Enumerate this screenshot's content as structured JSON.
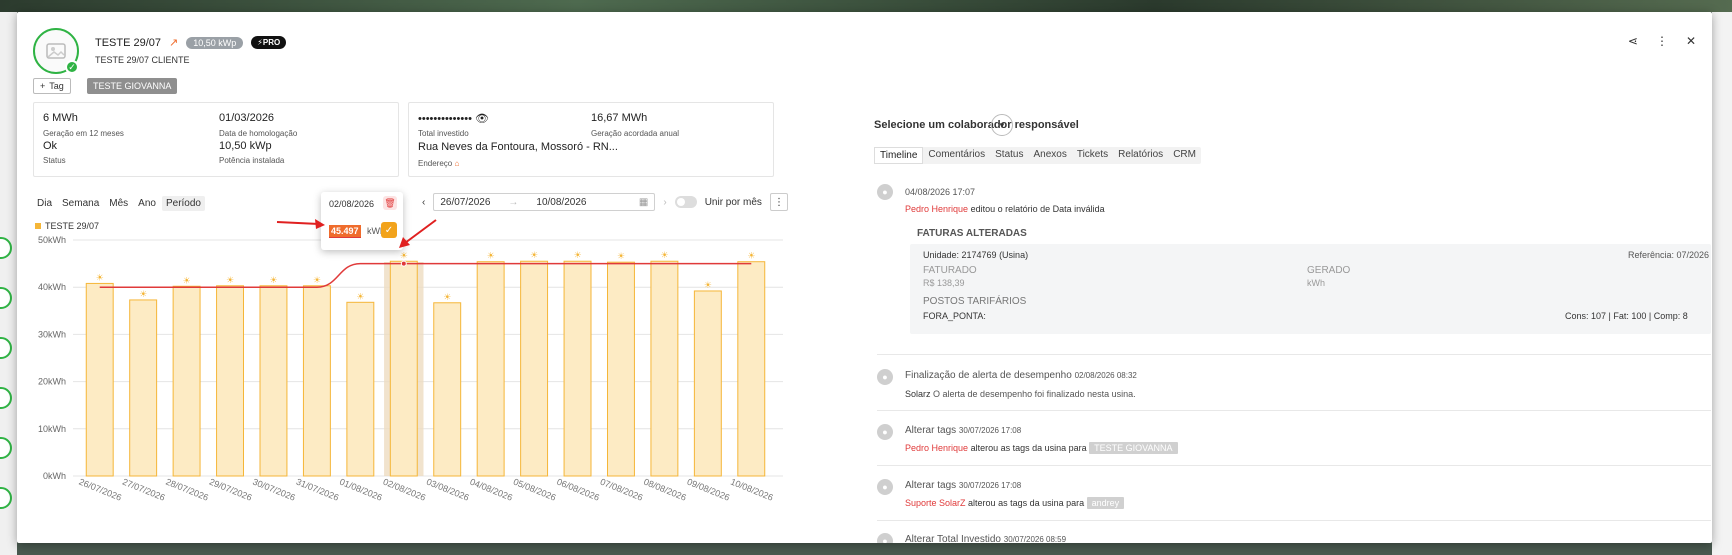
{
  "header": {
    "title": "TESTE 29/07",
    "power_badge": "10,50 kWp",
    "pro_badge": "PRO",
    "subtitle": "TESTE 29/07 CLIENTE",
    "tag_button": "Tag",
    "tag_chip": "TESTE GIOVANNA"
  },
  "card1": {
    "gen_value": "6 MWh",
    "gen_label": "Geração em 12 meses",
    "status_value": "Ok",
    "status_label": "Status",
    "date_value": "01/03/2026",
    "date_label": "Data de homologação",
    "power_value": "10,50 kWp",
    "power_label": "Potência instalada"
  },
  "card2": {
    "invested_value": "••••••••••••••",
    "invested_label": "Total investido",
    "agreed_value": "16,67 MWh",
    "agreed_label": "Geração acordada anual",
    "address_value": "Rua Neves da Fontoura, Mossoró - RN...",
    "address_label": "Endereço"
  },
  "periods": [
    "Dia",
    "Semana",
    "Mês",
    "Ano",
    "Período"
  ],
  "date_range": {
    "start": "26/07/2026",
    "end": "10/08/2026",
    "merge_label": "Unir por mês"
  },
  "popup": {
    "date": "02/08/2026",
    "value": "45.497",
    "unit": "kWh"
  },
  "right": {
    "responsible_title": "Selecione um colaborador responsável",
    "tabs": [
      "Timeline",
      "Comentários",
      "Status",
      "Anexos",
      "Tickets",
      "Relatórios",
      "CRM"
    ]
  },
  "timeline": {
    "t1_date": "04/08/2026 17:07",
    "t1_user": "Pedro Henrique",
    "t1_text": "editou o relatório de Data inválida",
    "invoice_title": "FATURAS ALTERADAS",
    "unit": "Unidade: 2174769 (Usina)",
    "reference": "Referência: 07/2026",
    "faturado_label": "FATURADO",
    "faturado_value": "R$ 138,39",
    "gerado_label": "GERADO",
    "gerado_value": "kWh",
    "postos_label": "POSTOS TARIFÁRIOS",
    "fora_ponta": "FORA_PONTA:",
    "fora_ponta_values": "Cons: 107 | Fat: 100 | Comp: 8",
    "t2_title": "Finalização de alerta de desempenho",
    "t2_date": "02/08/2026 08:32",
    "t2_user": "Solarz",
    "t2_text": "O alerta de desempenho foi finalizado nesta usina.",
    "t3_title": "Alterar tags",
    "t3_date": "30/07/2026 17:08",
    "t3_user": "Pedro Henrique",
    "t3_text": "alterou as tags da usina para",
    "t3_tag": "TESTE GIOVANNA",
    "t4_title": "Alterar tags",
    "t4_date": "30/07/2026 17:08",
    "t4_user": "Suporte SolarZ",
    "t4_text": "alterou as tags da usina para",
    "t4_tag": "andrey",
    "t5_title": "Alterar Total Investido",
    "t5_date": "30/07/2026 08:59"
  },
  "chart_data": {
    "type": "bar",
    "legend": "TESTE 29/07",
    "categories": [
      "26/07/2026",
      "27/07/2026",
      "28/07/2026",
      "29/07/2026",
      "30/07/2026",
      "31/07/2026",
      "01/08/2026",
      "02/08/2026",
      "03/08/2026",
      "04/08/2026",
      "05/08/2026",
      "06/08/2026",
      "07/08/2026",
      "08/08/2026",
      "09/08/2026",
      "10/08/2026"
    ],
    "values": [
      40800,
      37300,
      40200,
      40300,
      40300,
      40300,
      36800,
      45497,
      36700,
      45400,
      45500,
      45500,
      45300,
      45500,
      39200,
      45400
    ],
    "expected": [
      40000,
      40000,
      40000,
      40000,
      40000,
      40000,
      45000,
      45000,
      45000,
      45000,
      45000,
      45000,
      45000,
      45000,
      45000,
      45000
    ],
    "ylim": [
      0,
      50000
    ],
    "yticks": [
      "0kWh",
      "10kWh",
      "20kWh",
      "30kWh",
      "40kWh",
      "50kWh"
    ],
    "highlight_index": 7,
    "colors": {
      "bar_fill": "#fdebc4",
      "bar_stroke": "#f5b638",
      "line": "#e03a3a",
      "highlight": "#eddcc0"
    }
  }
}
